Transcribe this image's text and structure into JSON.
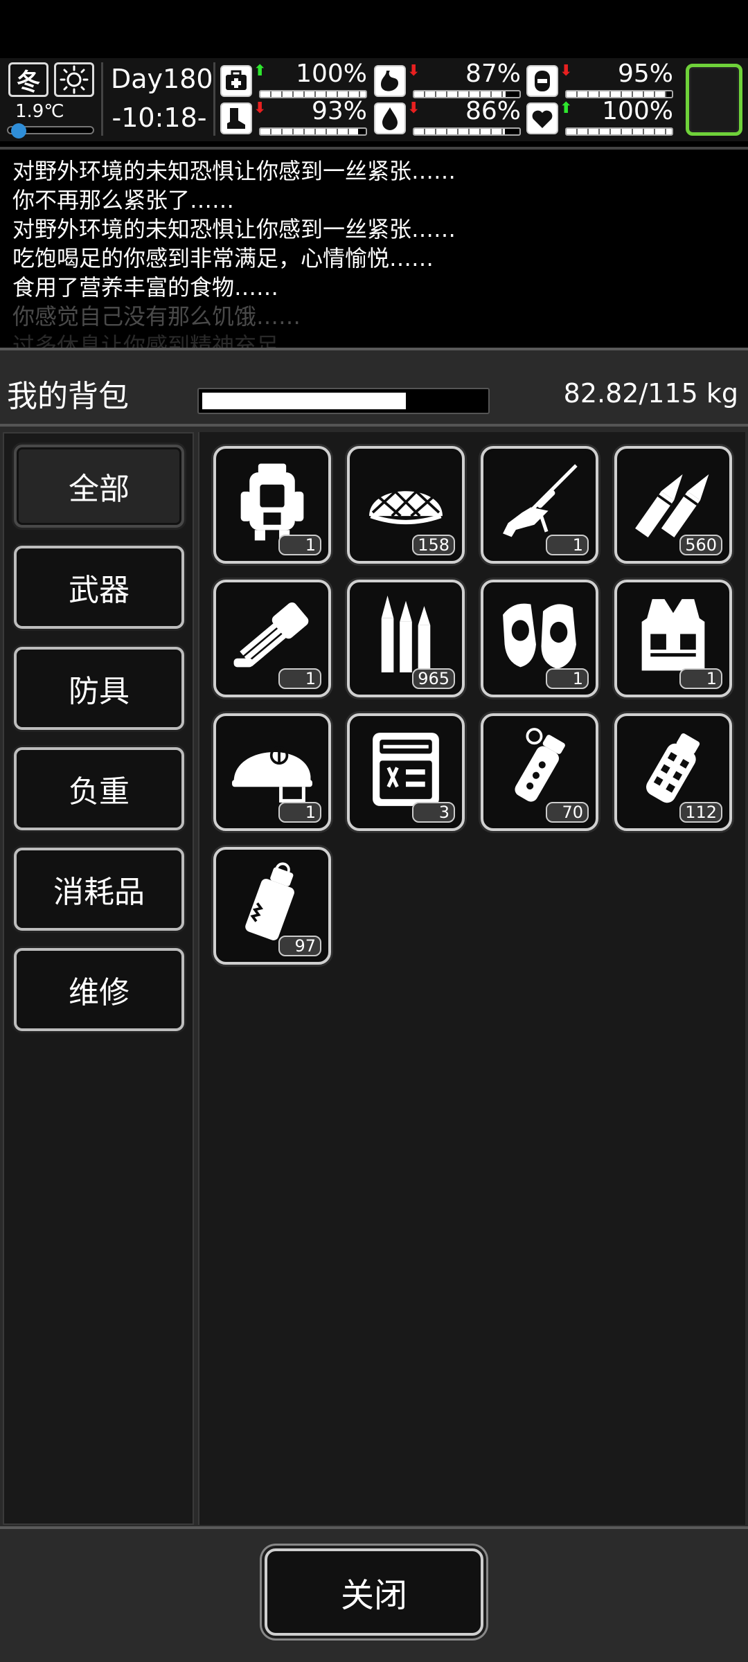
{
  "status": {
    "season": "冬",
    "weather_icon": "sun-icon",
    "temperature": "1.9℃",
    "day": "Day180",
    "time": "-10:18-",
    "stats": [
      {
        "name": "health",
        "icon": "medkit-icon",
        "trend": "up",
        "value": "100%",
        "level": 1.0
      },
      {
        "name": "hunger",
        "icon": "stomach-icon",
        "trend": "down",
        "value": "87%",
        "level": 0.87
      },
      {
        "name": "mood",
        "icon": "mask-icon",
        "trend": "down",
        "value": "95%",
        "level": 0.95
      },
      {
        "name": "stamina",
        "icon": "boot-icon",
        "trend": "down",
        "value": "93%",
        "level": 0.93
      },
      {
        "name": "thirst",
        "icon": "water-drop-icon",
        "trend": "down",
        "value": "86%",
        "level": 0.86
      },
      {
        "name": "heart",
        "icon": "heart-icon",
        "trend": "up",
        "value": "100%",
        "level": 1.0
      }
    ],
    "accent_color": "#6fd23a"
  },
  "log": [
    "对野外环境的未知恐惧让你感到一丝紧张……",
    "你不再那么紧张了……",
    "对野外环境的未知恐惧让你感到一丝紧张……",
    "吃饱喝足的你感到非常满足，心情愉悦……",
    "食用了营养丰富的食物……",
    "你感觉自己没有那么饥饿……",
    "过多休息让你感到精神充足"
  ],
  "backpack": {
    "title": "我的背包",
    "weight_text": "82.82/115 kg",
    "weight_fraction": 0.72,
    "categories": [
      {
        "label": "全部",
        "active": true
      },
      {
        "label": "武器",
        "active": false
      },
      {
        "label": "防具",
        "active": false
      },
      {
        "label": "负重",
        "active": false
      },
      {
        "label": "消耗品",
        "active": false
      },
      {
        "label": "维修",
        "active": false
      }
    ],
    "items": [
      {
        "icon": "backpack-icon",
        "count": "1"
      },
      {
        "icon": "camo-net-helmet-icon",
        "count": "158"
      },
      {
        "icon": "sniper-rifle-icon",
        "count": "1"
      },
      {
        "icon": "rifle-bullets-icon",
        "count": "560"
      },
      {
        "icon": "minigun-icon",
        "count": "1"
      },
      {
        "icon": "ammo-rounds-icon",
        "count": "965"
      },
      {
        "icon": "knee-pads-icon",
        "count": "1"
      },
      {
        "icon": "tactical-vest-icon",
        "count": "1"
      },
      {
        "icon": "combat-helmet-icon",
        "count": "1"
      },
      {
        "icon": "toolkit-icon",
        "count": "3"
      },
      {
        "icon": "stun-grenade-icon",
        "count": "70"
      },
      {
        "icon": "frag-grenade-icon",
        "count": "112"
      },
      {
        "icon": "smoke-grenade-icon",
        "count": "97"
      }
    ],
    "close_label": "关闭"
  }
}
